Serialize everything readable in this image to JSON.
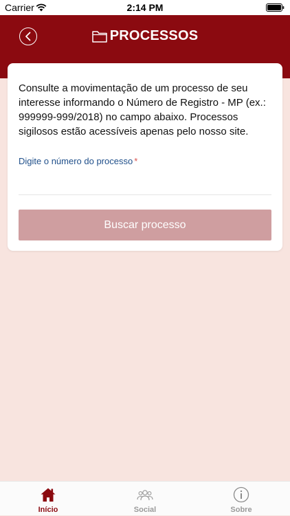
{
  "status": {
    "carrier": "Carrier",
    "time": "2:14 PM"
  },
  "header": {
    "title": "PROCESSOS",
    "color": "#8b0a10"
  },
  "card": {
    "intro": "Consulte a movimentação de um processo de seu interesse informando o Número de Registro - MP (ex.: 999999-999/2018) no campo abaixo. Processos sigilosos estão acessíveis apenas pelo nosso site.",
    "field_label": "Digite o número do processo",
    "required_mark": "*",
    "input_value": "",
    "button_label": "Buscar processo"
  },
  "tabs": [
    {
      "label": "Início",
      "icon": "home-icon",
      "active": true
    },
    {
      "label": "Social",
      "icon": "people-icon",
      "active": false
    },
    {
      "label": "Sobre",
      "icon": "info-icon",
      "active": false
    }
  ],
  "colors": {
    "accent": "#8b0a10",
    "button_disabled": "#cf9ea0",
    "background": "#f8e4df",
    "label": "#1f4f8a"
  }
}
